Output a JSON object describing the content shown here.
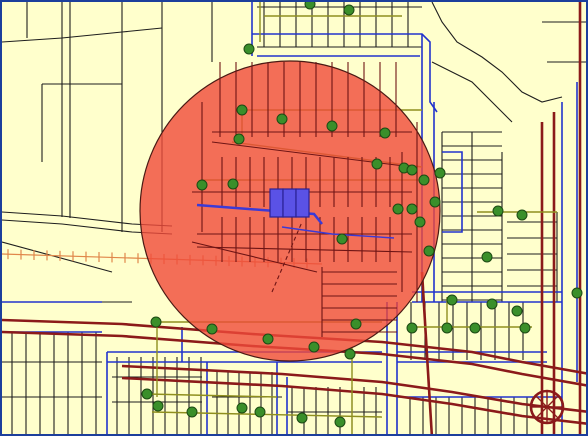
{
  "map": {
    "type": "parcel-map",
    "colors": {
      "land": "#ffffcc",
      "lot_line": "#1e1e1e",
      "road_centerline": "#8b1a1a",
      "road_edge": "#2233cc",
      "utility_line": "#8f8f1e",
      "utility_node": "#3a8f2a",
      "rail": "#e0874a",
      "buffer_fill": "#f04a3a",
      "selected_parcel": "#5a52e6",
      "frame": "#1c3f9c"
    },
    "layers": [
      {
        "name": "parcels",
        "feature": "lot-lines"
      },
      {
        "name": "roads",
        "feature": "road-centerlines"
      },
      {
        "name": "street-edges",
        "feature": "curb-lines"
      },
      {
        "name": "utilities",
        "feature": "pipe-network"
      },
      {
        "name": "utility-nodes",
        "feature": "valves-manholes"
      },
      {
        "name": "rail",
        "feature": "rail-line"
      },
      {
        "name": "buffer",
        "feature": "notification-radius"
      },
      {
        "name": "selection",
        "feature": "subject-parcels"
      }
    ],
    "selected_parcel_count": 3
  }
}
